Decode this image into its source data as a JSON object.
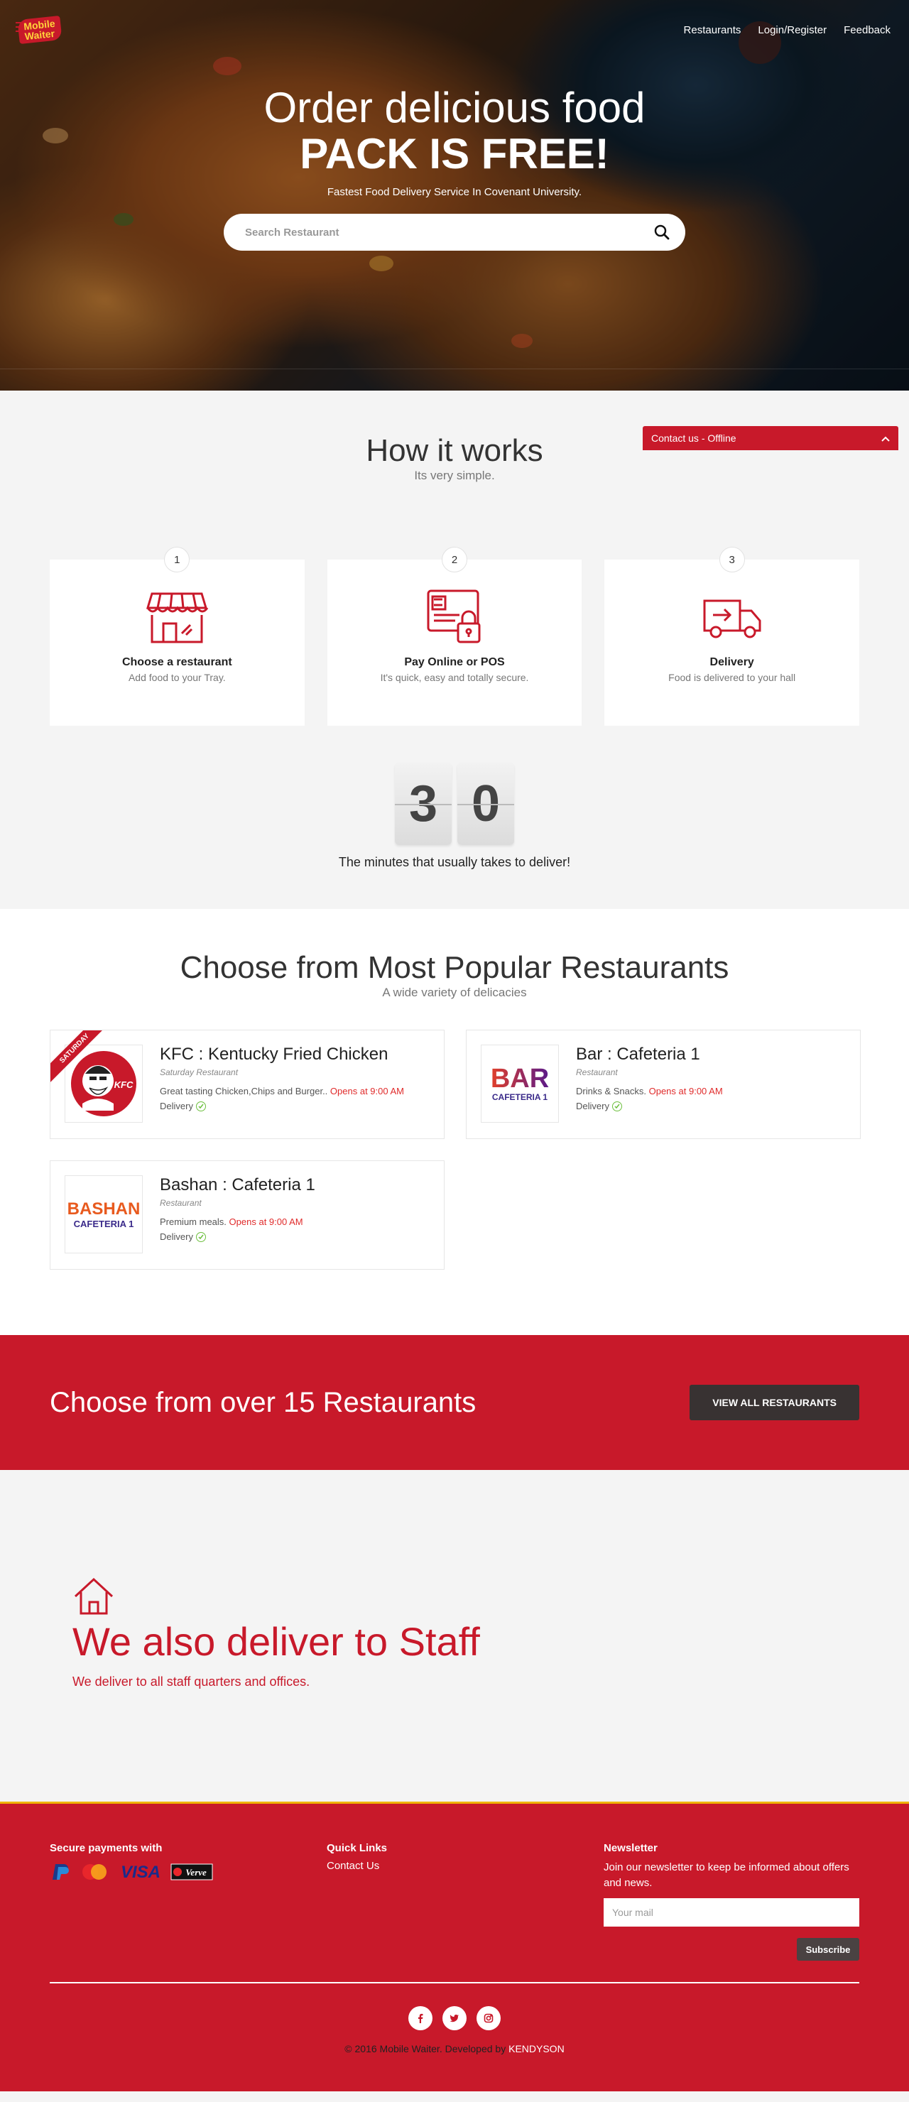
{
  "header": {
    "logo": {
      "line1": "Mobile",
      "line2": "Waiter"
    },
    "nav": [
      "Restaurants",
      "Login/Register",
      "Feedback"
    ]
  },
  "hero": {
    "title1": "Order delicious food",
    "title2": "PACK IS FREE!",
    "subtitle": "Fastest Food Delivery Service In Covenant University.",
    "search_placeholder": "Search Restaurant"
  },
  "contact_bar": {
    "label": "Contact us - Offline"
  },
  "how": {
    "title": "How it works",
    "subtitle": "Its very simple.",
    "steps": [
      {
        "num": "1",
        "title": "Choose a restaurant",
        "desc": "Add food to your Tray.",
        "icon": "store-icon"
      },
      {
        "num": "2",
        "title": "Pay Online or POS",
        "desc": "It's quick, easy and totally secure.",
        "icon": "secure-payment-icon"
      },
      {
        "num": "3",
        "title": "Delivery",
        "desc": "Food is delivered to your hall",
        "icon": "delivery-truck-icon"
      }
    ],
    "counter_digits": [
      "3",
      "0"
    ],
    "counter_caption": "The minutes that usually takes to deliver!"
  },
  "popular": {
    "title": "Choose from Most Popular Restaurants",
    "subtitle": "A wide variety of delicacies",
    "restaurants": [
      {
        "name": "KFC : Kentucky Fried Chicken",
        "type": "Saturday Restaurant",
        "desc": "Great tasting Chicken,Chips and Burger..",
        "opens": "Opens at 9:00 AM",
        "delivery": "Delivery",
        "ribbon": "SATURDAY"
      },
      {
        "name": "Bar : Cafeteria 1",
        "type": "Restaurant",
        "desc": "Drinks & Snacks.",
        "opens": "Opens at 9:00 AM",
        "delivery": "Delivery"
      },
      {
        "name": "Bashan : Cafeteria 1",
        "type": "Restaurant",
        "desc": "Premium meals.",
        "opens": "Opens at 9:00 AM",
        "delivery": "Delivery"
      }
    ],
    "logos": {
      "kfc": "KFC",
      "bar": {
        "line1": "BAR",
        "line2": "CAFETERIA 1"
      },
      "bashan": {
        "line1": "BASHAN",
        "line2": "CAFETERIA 1"
      }
    }
  },
  "cta": {
    "title": "Choose from over 15 Restaurants",
    "button": "VIEW ALL RESTAURANTS"
  },
  "staff": {
    "title": "We also deliver to Staff",
    "subtitle": "We deliver to all staff quarters and offices."
  },
  "footer": {
    "payments_title": "Secure payments with",
    "payments": [
      "PayPal",
      "MasterCard",
      "VISA",
      "Verve"
    ],
    "quick_links_title": "Quick Links",
    "quick_links": [
      "Contact Us"
    ],
    "newsletter_title": "Newsletter",
    "newsletter_text": "Join our newsletter to keep be informed about offers and news.",
    "mail_placeholder": "Your mail",
    "subscribe": "Subscribe",
    "socials": [
      "facebook-icon",
      "twitter-icon",
      "instagram-icon"
    ],
    "copyright": "© 2016 Mobile Waiter. Developed by",
    "developer": "KENDYSON"
  },
  "colors": {
    "brand_red": "#c8192a",
    "accent_yellow": "#f0b200",
    "dark_button": "#383232"
  }
}
